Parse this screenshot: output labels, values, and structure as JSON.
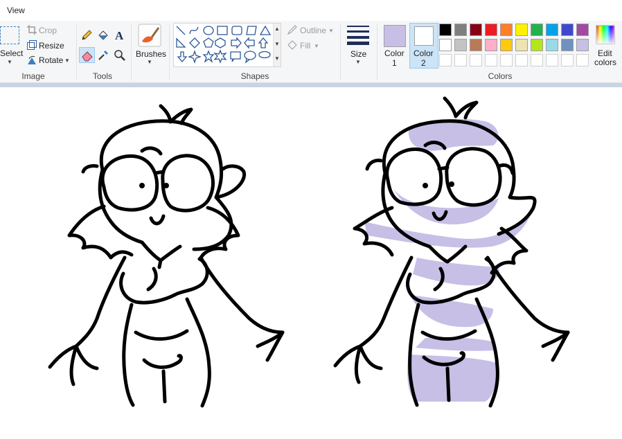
{
  "menu": {
    "view": "View"
  },
  "image_group": {
    "label": "Image",
    "select": "Select",
    "crop": "Crop",
    "resize": "Resize",
    "rotate": "Rotate"
  },
  "tools_group": {
    "label": "Tools"
  },
  "brushes_group": {
    "label": "Brushes"
  },
  "shapes_group": {
    "label": "Shapes",
    "outline": "Outline",
    "fill": "Fill"
  },
  "size_group": {
    "label": "Size"
  },
  "colors_group": {
    "label": "Colors",
    "color1_label": "Color",
    "color1_num": "1",
    "color2_label": "Color",
    "color2_num": "2",
    "edit_colors_1": "Edit",
    "edit_colors_2": "colors",
    "color1_value": "#c8bfe7",
    "color2_value": "#ffffff",
    "palette_row1": [
      "#000000",
      "#7f7f7f",
      "#880015",
      "#ed1c24",
      "#ff7f27",
      "#fff200",
      "#22b14c",
      "#00a2e8",
      "#3f48cc",
      "#a349a4"
    ],
    "palette_row2": [
      "#ffffff",
      "#c3c3c3",
      "#b97a57",
      "#ffaec9",
      "#ffc90e",
      "#efe4b0",
      "#b5e61d",
      "#99d9ea",
      "#7092be",
      "#c8bfe7"
    ]
  },
  "drawing": {
    "fill_color": "#c8bfe7",
    "line_color": "#000000"
  }
}
